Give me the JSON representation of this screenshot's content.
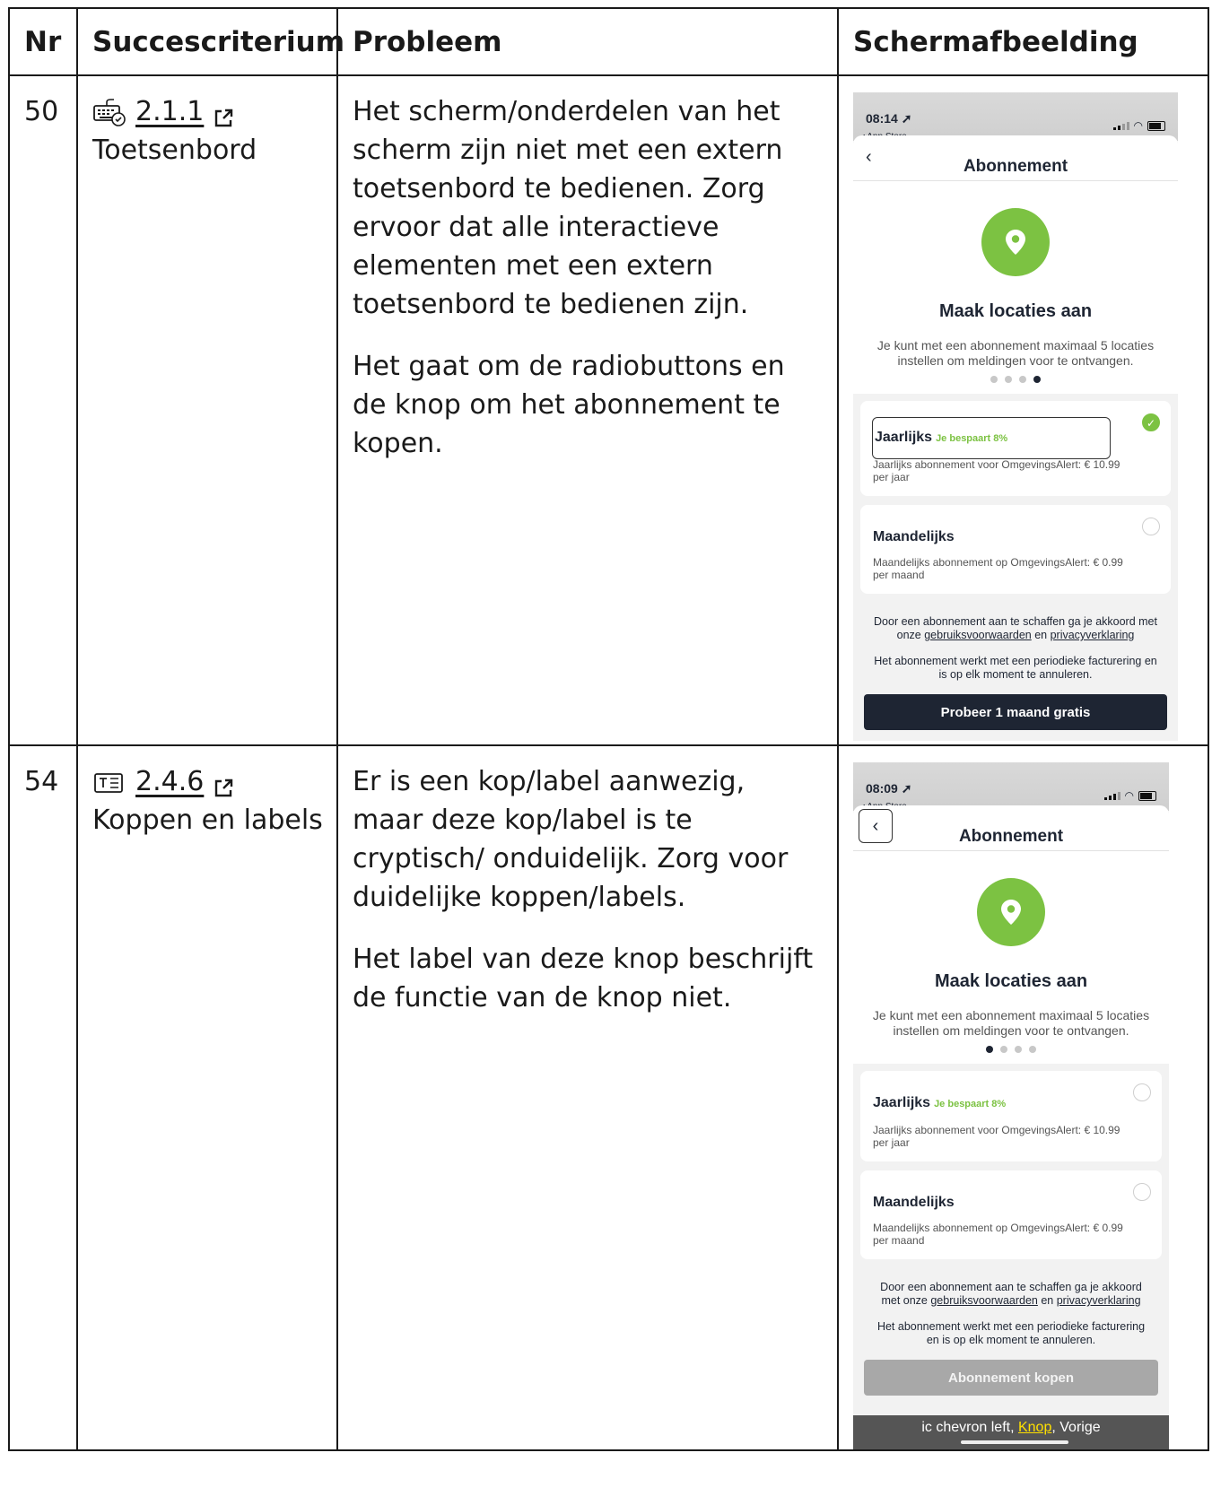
{
  "table": {
    "headers": {
      "nr": "Nr",
      "criterion": "Succescriterium",
      "problem": "Probleem",
      "screenshot": "Schermafbeelding"
    },
    "rows": [
      {
        "nr": "50",
        "criterion_code": "2.1.1",
        "criterion_name": "Toetsenbord",
        "criterion_icon": "keyboard-icon",
        "problem_paragraphs": [
          "Het scherm/onderdelen van het scherm zijn niet met een extern toetsenbord te bedienen. Zorg ervoor dat alle interactieve elementen met een extern toetsenbord te bedienen zijn.",
          "Het gaat om de radiobuttons en de knop om het abonnement te kopen."
        ],
        "screenshot": {
          "time": "08:14",
          "store_back": "◂ App Store",
          "nav_title": "Abonnement",
          "back_symbol": "‹",
          "feature_title": "Maak locaties aan",
          "feature_text": "Je kunt met een abonnement maximaal 5 locaties instellen om meldingen voor te ontvangen.",
          "plans": [
            {
              "name": "Jaarlijks",
              "badge": "Je bespaart 8%",
              "desc": "Jaarlijks abonnement voor OmgevingsAlert: € 10.99 per jaar",
              "selected": true
            },
            {
              "name": "Maandelijks",
              "badge": "",
              "desc": "Maandelijks abonnement op OmgevingsAlert: € 0.99 per maand",
              "selected": false
            }
          ],
          "legal_1_pre": "Door een abonnement aan te schaffen ga je akkoord met onze ",
          "legal_1_link1": "gebruiksvoorwaarden",
          "legal_1_mid": " en ",
          "legal_1_link2": "privacyverklaring",
          "legal_2": "Het abonnement werkt met een periodieke facturering en is op elk moment te annuleren.",
          "cta": "Probeer 1 maand gratis"
        }
      },
      {
        "nr": "54",
        "criterion_code": "2.4.6",
        "criterion_name": "Koppen en labels",
        "criterion_icon": "text-heading-icon",
        "problem_paragraphs": [
          "Er is een kop/label aanwezig, maar deze kop/label is te cryptisch/ onduidelijk. Zorg voor duidelijke koppen/labels.",
          "Het label van deze knop beschrijft de functie van de knop niet."
        ],
        "screenshot": {
          "time": "08:09",
          "store_back": "◂ App Store",
          "nav_title": "Abonnement",
          "back_symbol": "‹",
          "feature_title": "Maak locaties aan",
          "feature_text": "Je kunt met een abonnement maximaal 5 locaties instellen om meldingen voor te ontvangen.",
          "plans": [
            {
              "name": "Jaarlijks",
              "badge": "Je bespaart 8%",
              "desc": "Jaarlijks abonnement voor OmgevingsAlert: € 10.99 per jaar",
              "selected": false
            },
            {
              "name": "Maandelijks",
              "badge": "",
              "desc": "Maandelijks abonnement op OmgevingsAlert: € 0.99 per maand",
              "selected": false
            }
          ],
          "legal_1_pre": "Door een abonnement aan te schaffen ga je akkoord met onze ",
          "legal_1_link1": "gebruiksvoorwaarden",
          "legal_1_mid": " en ",
          "legal_1_link2": "privacyverklaring",
          "legal_2": "Het abonnement werkt met een periodieke facturering en is op elk moment te annuleren.",
          "cta": "Abonnement kopen",
          "voiceover_pre": "ic chevron left, ",
          "voiceover_knop": "Knop",
          "voiceover_post": ", Vorige"
        }
      }
    ]
  },
  "colors": {
    "accent_green": "#7cc242",
    "navy": "#1e2533",
    "border": "#1a1a1a"
  }
}
